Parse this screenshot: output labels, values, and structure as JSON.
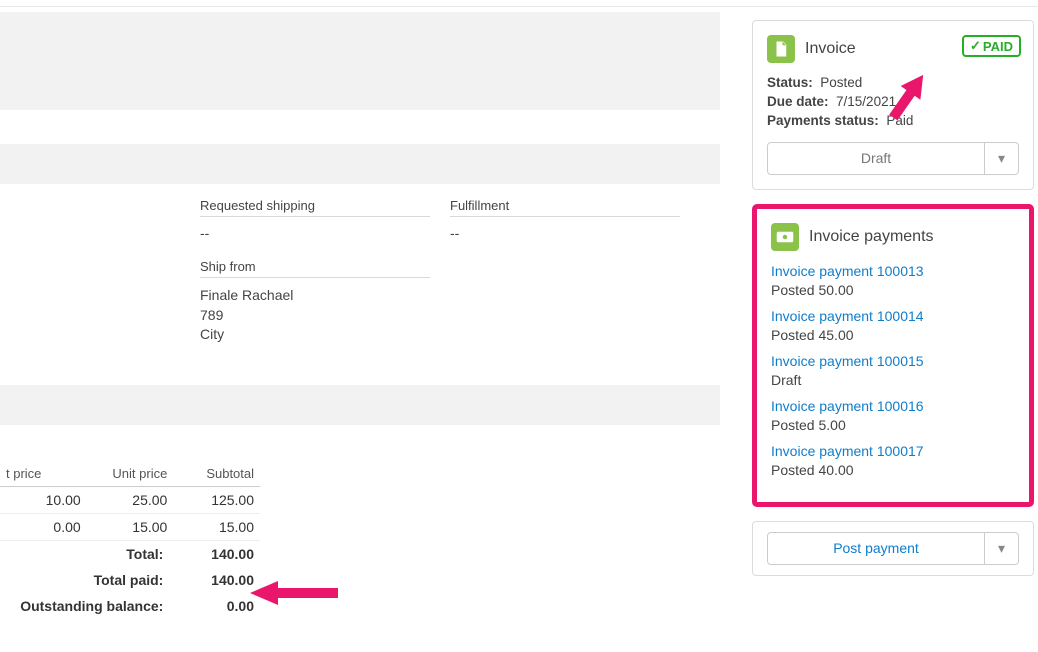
{
  "shipping": {
    "requested_label": "Requested shipping",
    "requested_value": "--",
    "fulfillment_label": "Fulfillment",
    "fulfillment_value": "--",
    "from_label": "Ship from",
    "from_name": "Finale Rachael",
    "from_addr1": "789",
    "from_city": "City"
  },
  "line_table": {
    "headers": {
      "price": "t price",
      "unit": "Unit price",
      "subtotal": "Subtotal"
    },
    "rows": [
      {
        "price": "10.00",
        "unit": "25.00",
        "subtotal": "125.00"
      },
      {
        "price": "0.00",
        "unit": "15.00",
        "subtotal": "15.00"
      }
    ],
    "totals": {
      "total_label": "Total:",
      "total_value": "140.00",
      "paid_label": "Total paid:",
      "paid_value": "140.00",
      "balance_label": "Outstanding balance:",
      "balance_value": "0.00"
    }
  },
  "invoice_card": {
    "title": "Invoice",
    "paid_badge": "PAID",
    "status_label": "Status:",
    "status_value": "Posted",
    "due_label": "Due date:",
    "due_value": "7/15/2021",
    "pay_status_label": "Payments status:",
    "pay_status_value": "Paid",
    "draft_button": "Draft"
  },
  "payments_card": {
    "title": "Invoice payments",
    "items": [
      {
        "link": "Invoice payment 100013",
        "sub": "Posted 50.00"
      },
      {
        "link": "Invoice payment 100014",
        "sub": "Posted 45.00"
      },
      {
        "link": "Invoice payment 100015",
        "sub": "Draft"
      },
      {
        "link": "Invoice payment 100016",
        "sub": "Posted 5.00"
      },
      {
        "link": "Invoice payment 100017",
        "sub": "Posted 40.00"
      }
    ],
    "post_button": "Post payment"
  },
  "colors": {
    "accent_green": "#8bc34a",
    "arrow_pink": "#e9166b",
    "link_blue": "#0f7dcb",
    "paid_green": "#27ae27"
  }
}
